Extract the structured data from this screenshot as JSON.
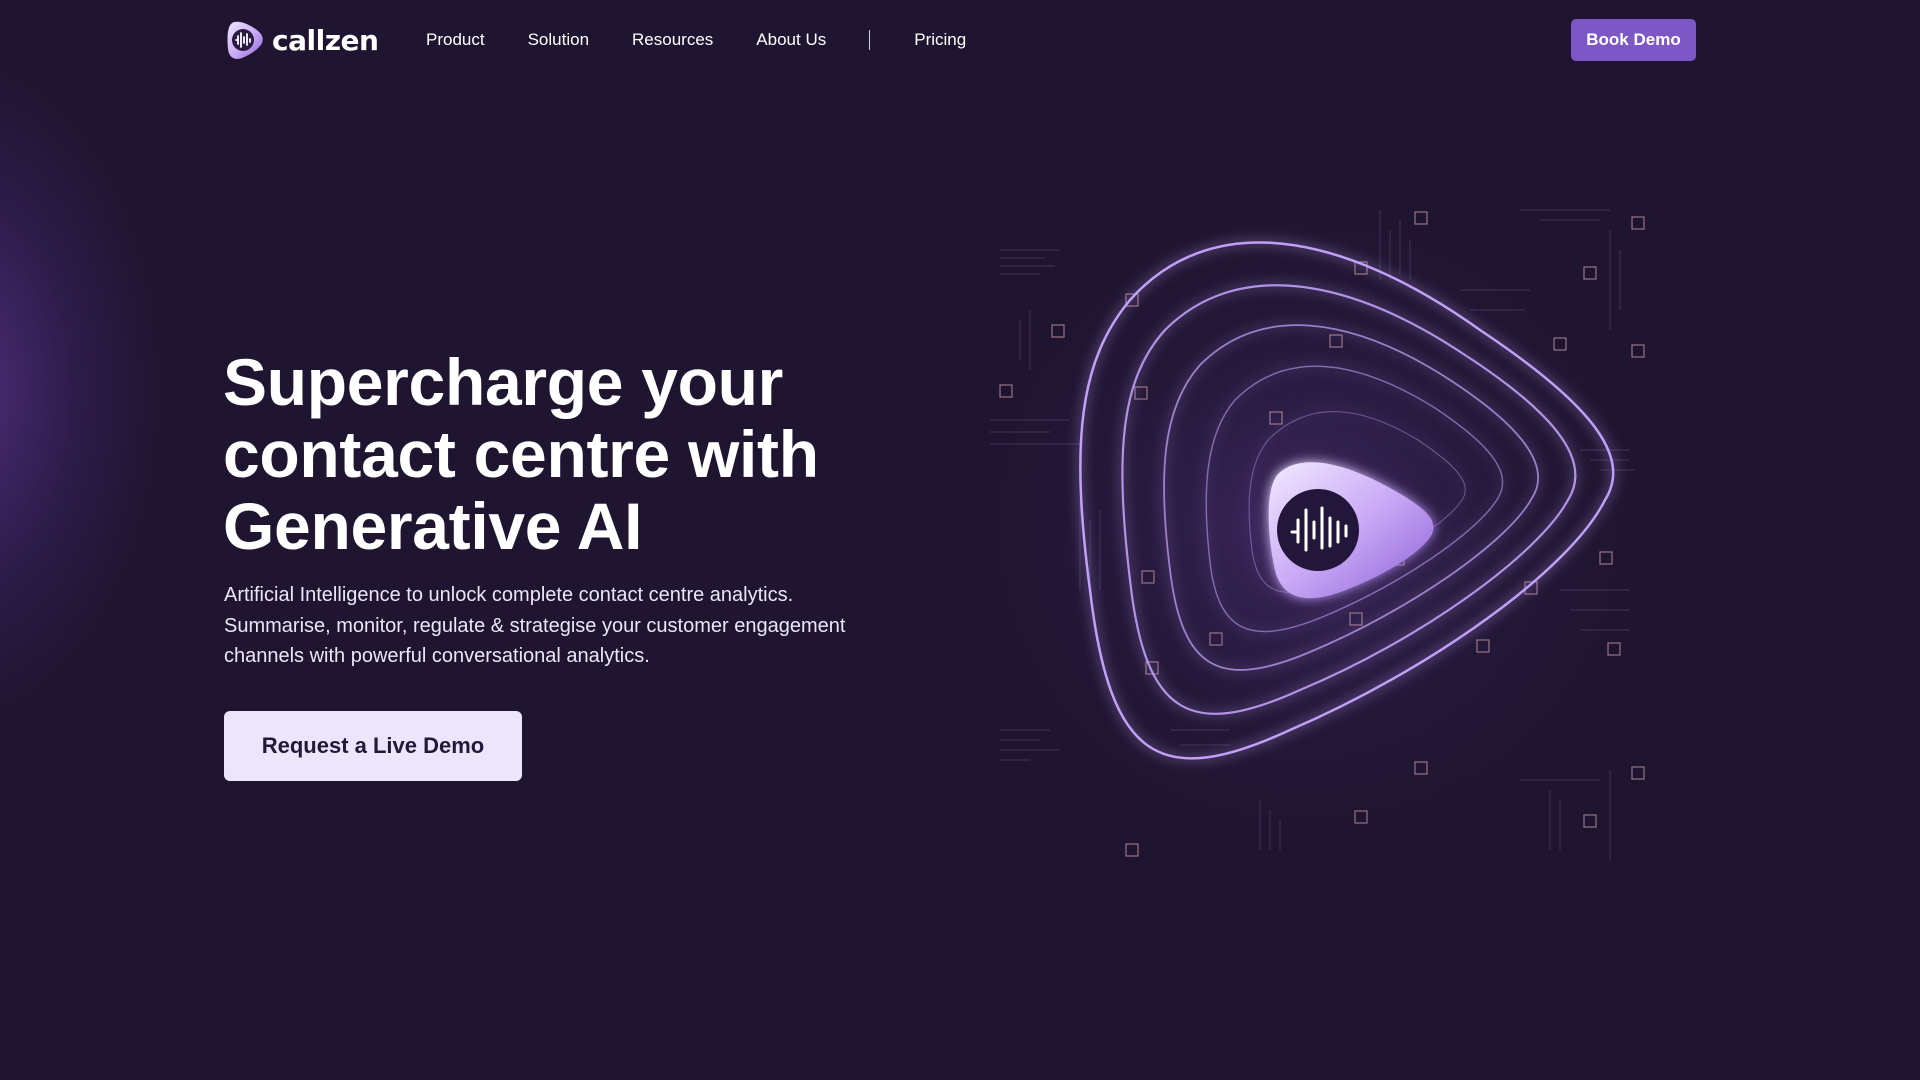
{
  "brand": {
    "name": "callzen",
    "logo_icon": "callzen-logo-icon"
  },
  "nav": {
    "items": [
      {
        "label": "Product"
      },
      {
        "label": "Solution"
      },
      {
        "label": "Resources"
      },
      {
        "label": "About Us"
      },
      {
        "label": "Pricing"
      }
    ],
    "cta_label": "Book Demo"
  },
  "hero": {
    "title_lines": [
      "Supercharge your",
      "contact centre with",
      "Generative AI"
    ],
    "subtitle_lines": [
      "Artificial Intelligence to unlock complete contact centre analytics.",
      "Summarise, monitor, regulate & strategise your customer engagement",
      "channels with powerful conversational analytics."
    ],
    "cta_label": "Request a Live Demo",
    "illustration_icon": "glowing-waveform-icon"
  },
  "colors": {
    "background": "#1f1530",
    "accent": "#7d57c5",
    "cta_background": "#ece5fb",
    "glow": "#b58cff"
  }
}
